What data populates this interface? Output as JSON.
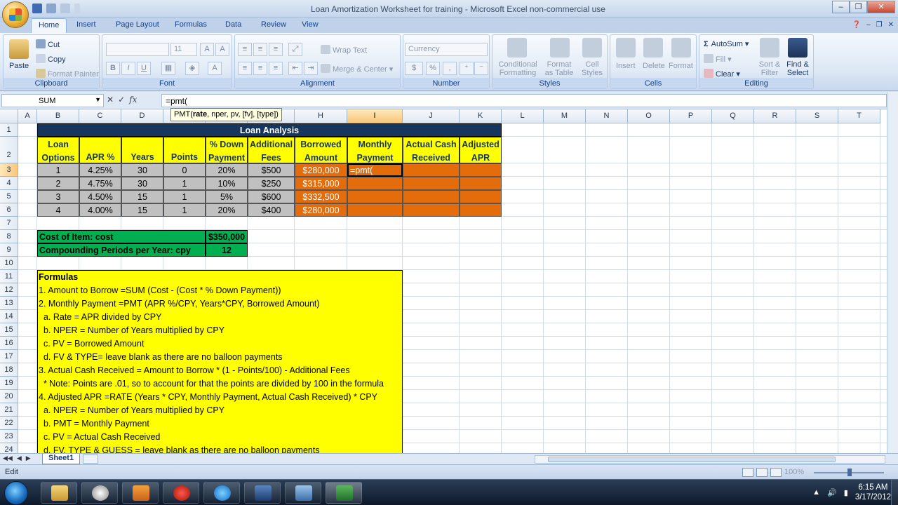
{
  "window": {
    "title": "Loan Amortization Worksheet for training  - Microsoft Excel non-commercial use",
    "controls": [
      "–",
      "❐",
      "✕"
    ]
  },
  "ribbon": {
    "tabs": [
      "Home",
      "Insert",
      "Page Layout",
      "Formulas",
      "Data",
      "Review",
      "View"
    ],
    "clipboard": {
      "paste": "Paste",
      "cut": "Cut",
      "copy": "Copy",
      "format_painter": "Format Painter",
      "label": "Clipboard"
    },
    "font": {
      "font_name": "",
      "font_size": "11",
      "bold": "B",
      "italic": "I",
      "underline": "U",
      "label": "Font"
    },
    "alignment": {
      "wrap_text": "Wrap Text",
      "merge_center": "Merge & Center",
      "label": "Alignment"
    },
    "number": {
      "format": "Currency",
      "dollar": "$",
      "percent": "%",
      "comma": ",",
      "label": "Number"
    },
    "styles": {
      "conditional": "Conditional",
      "conditional2": "Formatting",
      "format_as": "Format",
      "format_as2": "as Table",
      "cell_styles": "Cell",
      "cell_styles2": "Styles",
      "label": "Styles"
    },
    "cells": {
      "insert": "Insert",
      "delete": "Delete",
      "format": "Format",
      "label": "Cells"
    },
    "editing": {
      "autosum": "AutoSum",
      "fill": "Fill",
      "clear": "Clear",
      "sort": "Sort &",
      "sort2": "Filter",
      "find": "Find &",
      "find2": "Select",
      "label": "Editing"
    }
  },
  "formula_bar": {
    "name_box": "SUM",
    "formula": "=pmt(",
    "tooltip_prefix": "PMT(",
    "tooltip_bold": "rate",
    "tooltip_rest": ", nper, pv, [fv], [type])"
  },
  "columns": [
    "A",
    "B",
    "C",
    "D",
    "E",
    "F",
    "G",
    "H",
    "I",
    "J",
    "K",
    "L",
    "M",
    "N",
    "O",
    "P",
    "Q",
    "R",
    "S",
    "T"
  ],
  "rows": [
    "1",
    "2",
    "3",
    "4",
    "5",
    "6",
    "7",
    "8",
    "9",
    "10",
    "11",
    "12",
    "13",
    "14",
    "15",
    "16",
    "17",
    "18",
    "19",
    "20",
    "21",
    "22",
    "23",
    "24"
  ],
  "sheet": {
    "title": "Loan Analysis",
    "headers": [
      [
        "Loan",
        "Options"
      ],
      [
        "",
        "APR %"
      ],
      [
        "",
        "Years"
      ],
      [
        "",
        "Points"
      ],
      [
        "% Down",
        "Payment"
      ],
      [
        "Additional",
        "Fees"
      ],
      [
        "Borrowed",
        "Amount"
      ],
      [
        "Monthly",
        "Payment"
      ],
      [
        "Actual Cash",
        "Received"
      ],
      [
        "Adjusted",
        "APR"
      ]
    ],
    "data_rows": [
      [
        "1",
        "4.25%",
        "30",
        "0",
        "20%",
        "$500",
        "$280,000",
        "=pmt(",
        "",
        ""
      ],
      [
        "2",
        "4.75%",
        "30",
        "1",
        "10%",
        "$250",
        "$315,000",
        "",
        "",
        ""
      ],
      [
        "3",
        "4.50%",
        "15",
        "1",
        "5%",
        "$600",
        "$332,500",
        "",
        "",
        ""
      ],
      [
        "4",
        "4.00%",
        "15",
        "1",
        "20%",
        "$400",
        "$280,000",
        "",
        "",
        ""
      ]
    ],
    "cost_label": "Cost of Item: cost",
    "cost_value": "$350,000",
    "cpy_label": "Compounding Periods per Year: cpy",
    "cpy_value": "12",
    "formulas": [
      "Formulas",
      "1. Amount to Borrow =SUM (Cost - (Cost * % Down Payment))",
      "2. Monthly Payment =PMT (APR %/CPY, Years*CPY, Borrowed Amount)",
      "  a. Rate = APR divided by CPY",
      "  b. NPER = Number of Years multiplied by CPY",
      "  c. PV = Borrowed Amount",
      "  d. FV & TYPE= leave blank as there are no balloon payments",
      "3. Actual Cash Received = Amount to Borrow * (1 - Points/100) - Additional Fees",
      "  * Note: Points are .01, so to account for that the points are divided by 100 in the formula",
      "4. Adjusted APR =RATE (Years * CPY, Monthly Payment, Actual Cash Received) * CPY",
      "  a. NPER = Number of Years multiplied by CPY",
      "  b. PMT = Monthly Payment",
      "  c. PV = Actual Cash Received",
      "  d. FV, TYPE & GUESS = leave blank as there are no balloon payments"
    ]
  },
  "sheet_tab": "Sheet1",
  "status": {
    "mode": "Edit",
    "zoom": "100%"
  },
  "taskbar": {
    "time": "6:15 AM",
    "date": "3/17/2012"
  },
  "colors": {
    "yellow": "#ffff00",
    "navy": "#17365d",
    "gray": "#c0c0c0",
    "orange": "#e46c0a",
    "green": "#00b050"
  }
}
